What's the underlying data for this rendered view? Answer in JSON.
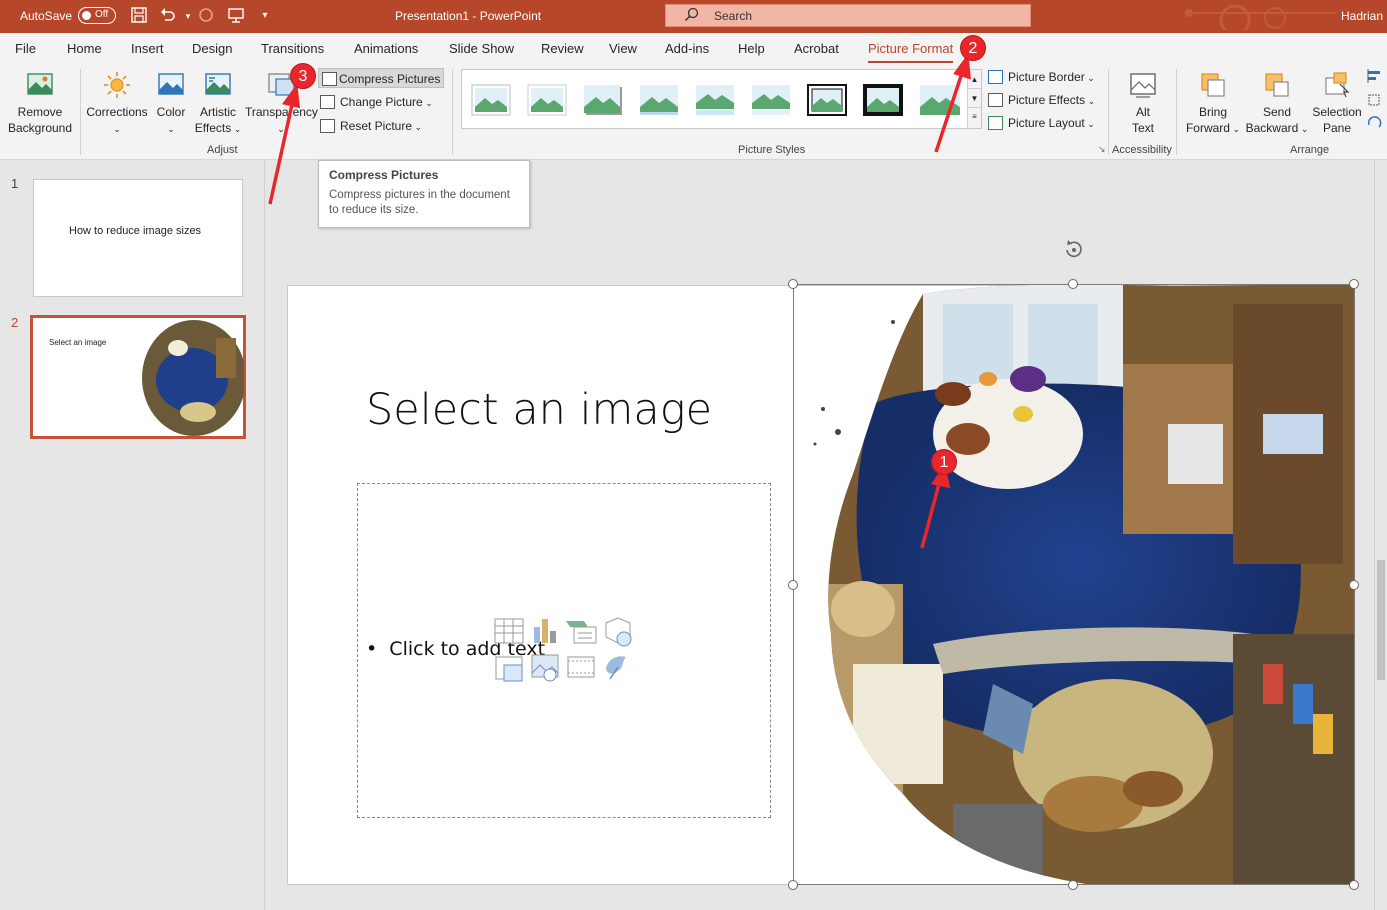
{
  "titlebar": {
    "autosave_label": "AutoSave",
    "autosave_state": "Off",
    "document_title": "Presentation1  -  PowerPoint",
    "search_placeholder": "Search",
    "user_name": "Hadrian",
    "brand_color": "#b7472a"
  },
  "ribbon_tabs": [
    {
      "label": "File"
    },
    {
      "label": "Home"
    },
    {
      "label": "Insert"
    },
    {
      "label": "Design"
    },
    {
      "label": "Transitions"
    },
    {
      "label": "Animations"
    },
    {
      "label": "Slide Show"
    },
    {
      "label": "Review"
    },
    {
      "label": "View"
    },
    {
      "label": "Add-ins"
    },
    {
      "label": "Help"
    },
    {
      "label": "Acrobat"
    },
    {
      "label": "Picture Format",
      "active": true
    }
  ],
  "ribbon": {
    "adjust": {
      "remove_background_line1": "Remove",
      "remove_background_line2": "Background",
      "corrections": "Corrections",
      "color": "Color",
      "artistic_effects_line1": "Artistic",
      "artistic_effects_line2": "Effects",
      "transparency": "Transparency",
      "compress_pictures": "Compress Pictures",
      "change_picture": "Change Picture",
      "reset_picture": "Reset Picture",
      "group_label": "Adjust"
    },
    "picture_styles": {
      "picture_border": "Picture Border",
      "picture_effects": "Picture Effects",
      "picture_layout": "Picture Layout",
      "group_label": "Picture Styles"
    },
    "accessibility": {
      "alt_text_line1": "Alt",
      "alt_text_line2": "Text",
      "group_label": "Accessibility"
    },
    "arrange": {
      "bring_forward_line1": "Bring",
      "bring_forward_line2": "Forward",
      "send_backward_line1": "Send",
      "send_backward_line2": "Backward",
      "selection_pane_line1": "Selection",
      "selection_pane_line2": "Pane",
      "group_label": "Arrange"
    }
  },
  "tooltip": {
    "title": "Compress Pictures",
    "body": "Compress pictures in the document to reduce its size."
  },
  "slides": [
    {
      "number": "1",
      "text": "How to reduce image sizes"
    },
    {
      "number": "2",
      "text": "Select an image",
      "active": true
    }
  ],
  "current_slide": {
    "title": "Select an image",
    "body_placeholder": "Click to add text"
  },
  "annotations": [
    {
      "number": "1"
    },
    {
      "number": "2"
    },
    {
      "number": "3"
    }
  ]
}
